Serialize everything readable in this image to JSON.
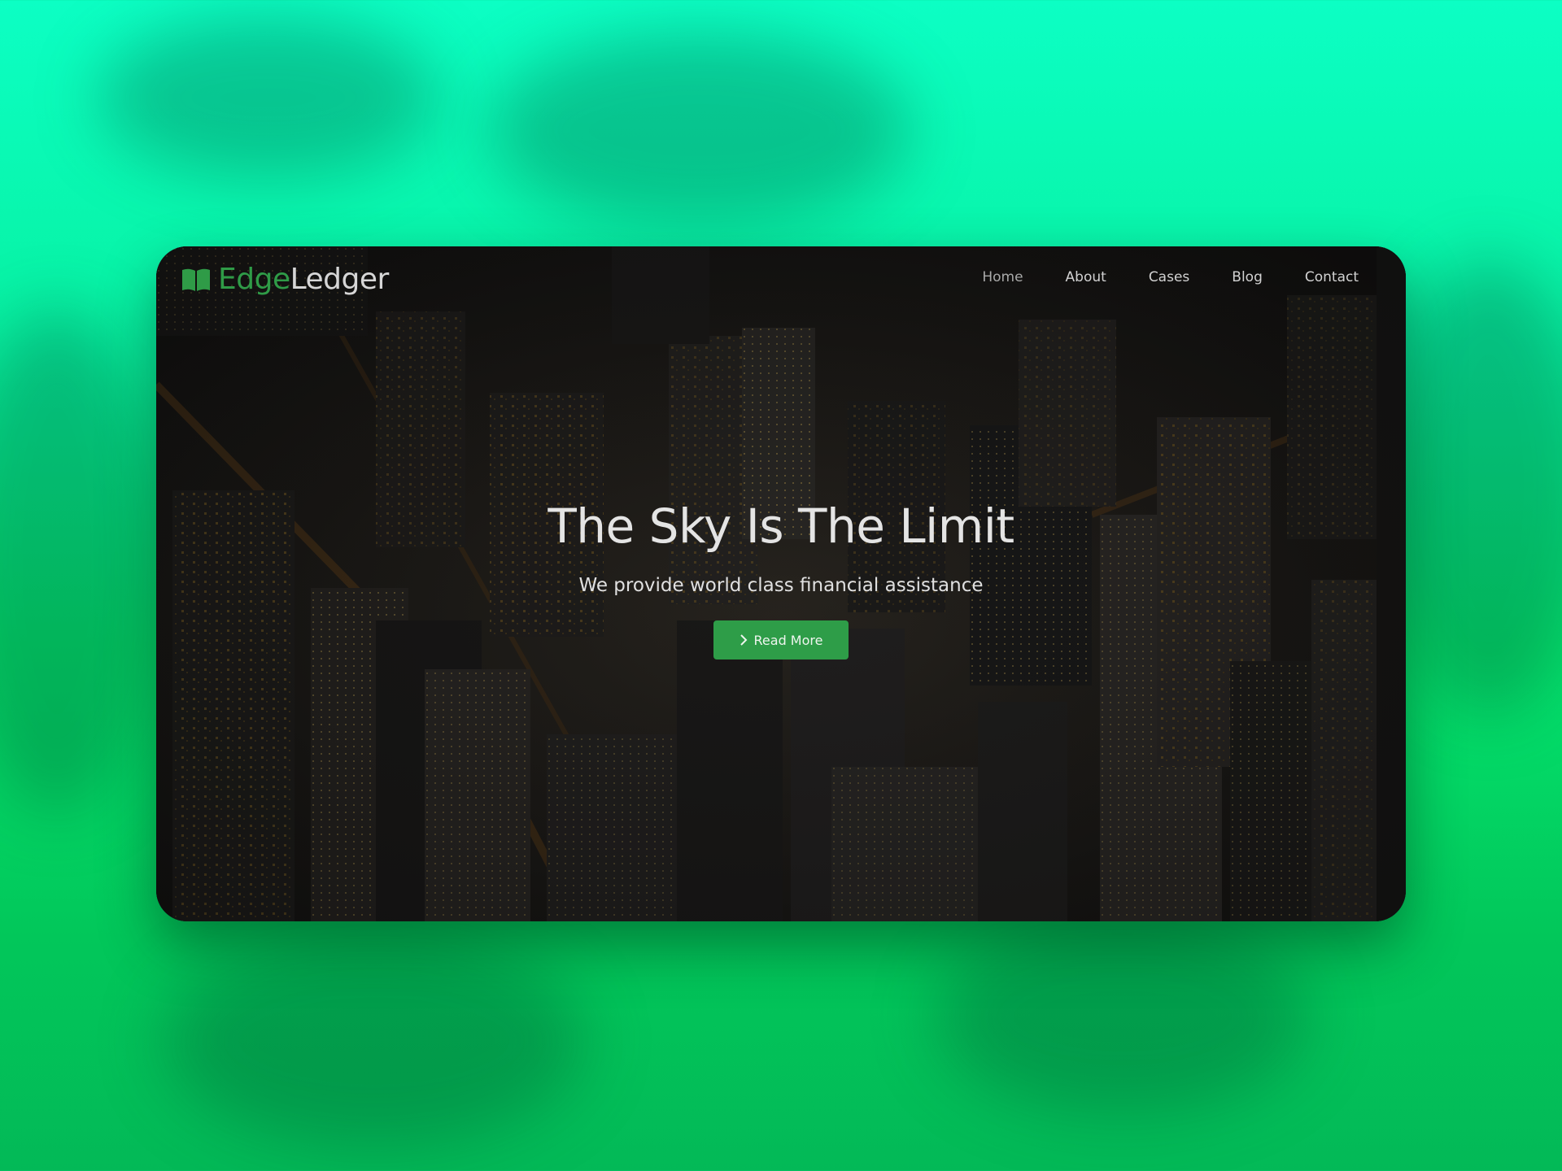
{
  "brand": {
    "name_part_1": "Edge",
    "name_part_2": "Ledger",
    "icon": "open-book-icon",
    "accent_color": "#2f9b47"
  },
  "nav": {
    "items": [
      {
        "label": "Home",
        "active": true
      },
      {
        "label": "About"
      },
      {
        "label": "Cases"
      },
      {
        "label": "Blog"
      },
      {
        "label": "Contact"
      }
    ]
  },
  "hero": {
    "title": "The Sky Is The Limit",
    "subtitle": "We provide world class financial assistance",
    "cta_label": "Read More",
    "cta_icon": "chevron-right-icon",
    "cta_color": "#2e9d48"
  },
  "background": {
    "page_color_top": "#0cffc4",
    "page_color_bottom": "#03b957",
    "hero_image": "night-city-aerial"
  }
}
